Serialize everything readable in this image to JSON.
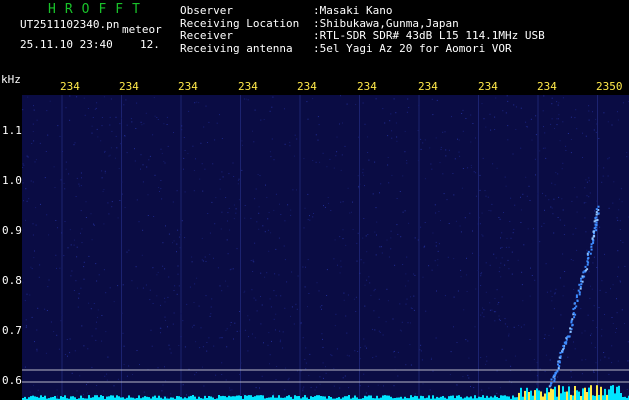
{
  "header": {
    "title": "HROFFT",
    "file_name": "UT2511102340.pn",
    "meta_label": "meteor",
    "datetime": "25.11.10 23:40",
    "extra_value": "12.",
    "unit_label": "kHz"
  },
  "station_info": [
    {
      "key": "Observer",
      "value": ":Masaki Kano"
    },
    {
      "key": "Receiving Location",
      "value": ":Shibukawa,Gunma,Japan"
    },
    {
      "key": "Receiver",
      "value": ":RTL-SDR SDR# 43dB L15 114.1MHz USB"
    },
    {
      "key": "Receiving antenna",
      "value": ":5el Yagi Az 20 for Aomori VOR"
    }
  ],
  "x_ticks": [
    "234",
    "234",
    "234",
    "234",
    "234",
    "234",
    "234",
    "234",
    "234",
    "2350"
  ],
  "y_ticks": [
    "1.1",
    "1.0",
    "0.9",
    "0.8",
    "0.7",
    "0.6"
  ],
  "colors": {
    "background": "#0a0c44",
    "trace": "#3d8bff",
    "baseline": "#00e5ff",
    "title": "#19c22a",
    "x_tick": "#ffe94a"
  },
  "chart_data": {
    "type": "scatter",
    "title": "",
    "xlabel": "",
    "ylabel": "kHz",
    "ylim": [
      0.57,
      1.2
    ],
    "xticks": [
      "234",
      "234",
      "234",
      "234",
      "234",
      "234",
      "234",
      "234",
      "234",
      "2350"
    ],
    "series": [
      {
        "points": [
          [
            2349.2,
            0.59
          ],
          [
            2349.3,
            0.62
          ],
          [
            2349.4,
            0.66
          ],
          [
            2349.5,
            0.69
          ],
          [
            2349.6,
            0.74
          ],
          [
            2349.7,
            0.79
          ],
          [
            2349.8,
            0.83
          ],
          [
            2349.9,
            0.88
          ],
          [
            2349.95,
            0.91
          ],
          [
            2350.0,
            0.95
          ]
        ]
      }
    ]
  }
}
